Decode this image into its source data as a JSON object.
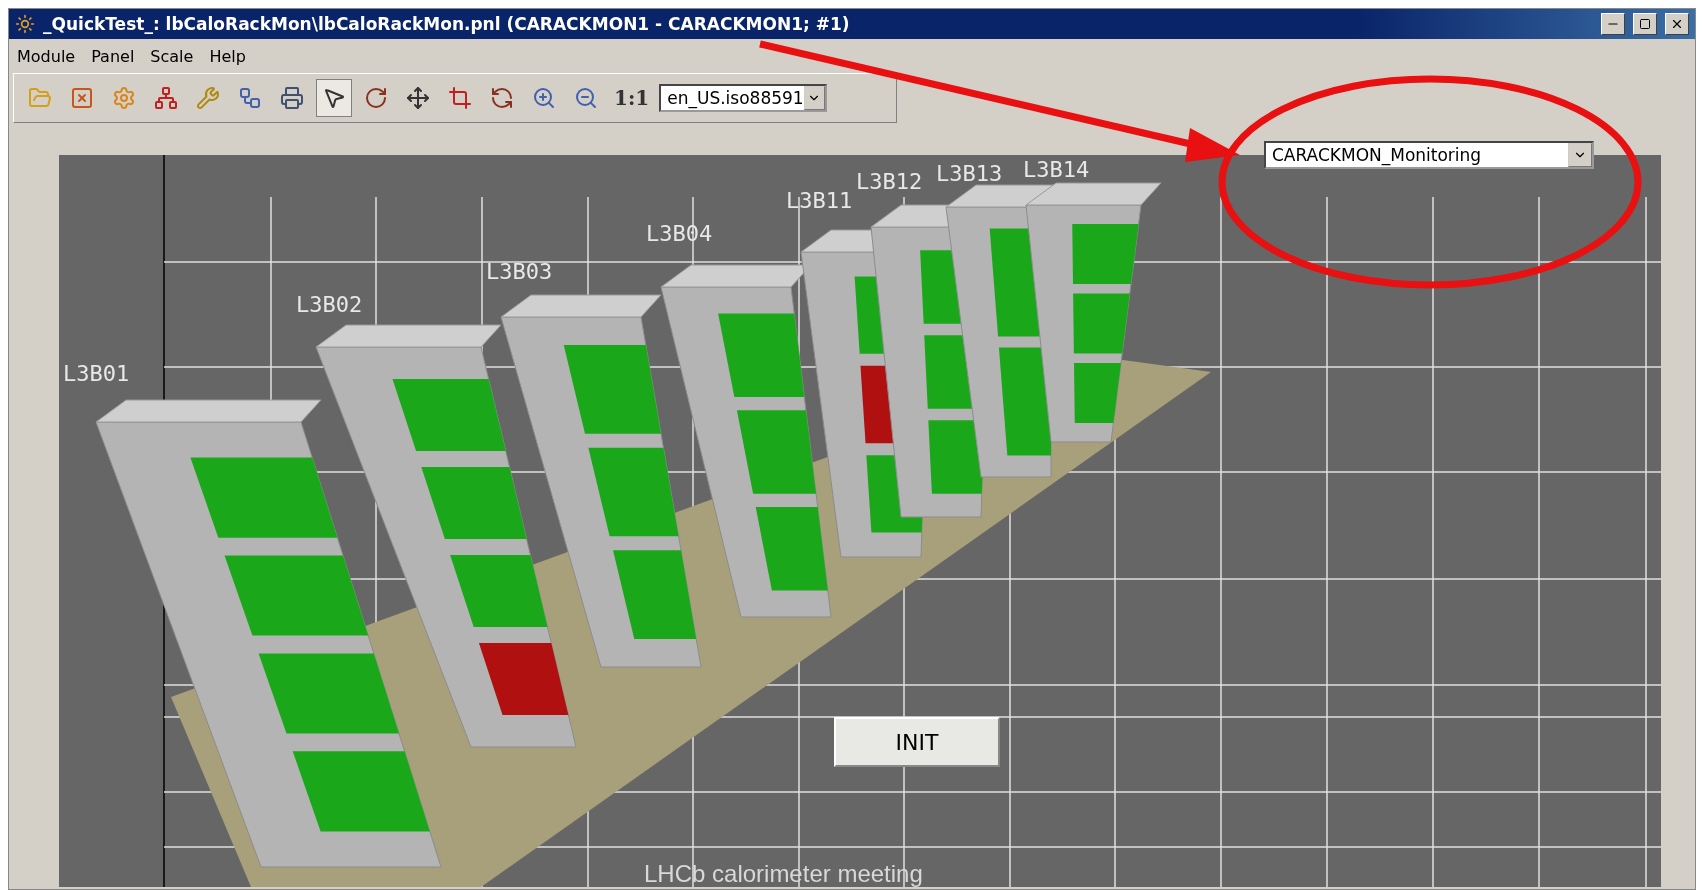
{
  "window": {
    "title": "_QuickTest_: lbCaloRackMon\\lbCaloRackMon.pnl (CARACKMON1 - CARACKMON1; #1)"
  },
  "menu": [
    "Module",
    "Panel",
    "Scale",
    "Help"
  ],
  "toolbar": {
    "tools": [
      {
        "kind": "open",
        "selected": false
      },
      {
        "kind": "close",
        "selected": false
      },
      {
        "kind": "gear",
        "selected": false
      },
      {
        "kind": "tree",
        "selected": false
      },
      {
        "kind": "tools",
        "selected": false
      },
      {
        "kind": "hierarchy",
        "selected": false
      },
      {
        "kind": "print",
        "selected": false
      },
      {
        "kind": "pointer",
        "selected": true
      },
      {
        "kind": "rotate",
        "selected": false
      },
      {
        "kind": "move",
        "selected": false
      },
      {
        "kind": "crop",
        "selected": false
      },
      {
        "kind": "reset",
        "selected": false
      },
      {
        "kind": "zoomin",
        "selected": false
      },
      {
        "kind": "zoomout",
        "selected": false
      },
      {
        "kind": "text",
        "label": "1:1",
        "selected": false
      }
    ],
    "locale": "en_US.iso88591"
  },
  "panel_selector": "CARACKMON_Monitoring",
  "racks": [
    {
      "label": "L3B01",
      "slots": [
        {
          "color": "#1aa81a"
        },
        {
          "color": "#1aa81a"
        },
        {
          "color": "#1aa81a"
        },
        {
          "color": "#1aa81a"
        }
      ]
    },
    {
      "label": "L3B02",
      "slots": [
        {
          "color": "#1aa81a"
        },
        {
          "color": "#1aa81a"
        },
        {
          "color": "#1aa81a"
        },
        {
          "color": "#b01010"
        }
      ]
    },
    {
      "label": "L3B03",
      "slots": [
        {
          "color": "#1aa81a"
        },
        {
          "color": "#1aa81a"
        },
        {
          "color": "#1aa81a"
        }
      ]
    },
    {
      "label": "L3B04",
      "slots": [
        {
          "color": "#1aa81a"
        },
        {
          "color": "#1aa81a"
        },
        {
          "color": "#1aa81a"
        }
      ]
    },
    {
      "label": "L3B11",
      "slots": [
        {
          "color": "#1aa81a"
        },
        {
          "color": "#b01010"
        },
        {
          "color": "#1aa81a"
        }
      ]
    },
    {
      "label": "L3B12",
      "slots": [
        {
          "color": "#1aa81a"
        },
        {
          "color": "#1aa81a"
        },
        {
          "color": "#1aa81a"
        }
      ]
    },
    {
      "label": "L3B13",
      "slots": [
        {
          "color": "#1aa81a"
        },
        {
          "color": "#1aa81a"
        }
      ]
    },
    {
      "label": "L3B14",
      "slots": [
        {
          "color": "#1aa81a"
        },
        {
          "color": "#1aa81a"
        },
        {
          "color": "#1aa81a"
        }
      ]
    }
  ],
  "init_button": "INIT",
  "footer": "LHCb calorimeter meeting"
}
